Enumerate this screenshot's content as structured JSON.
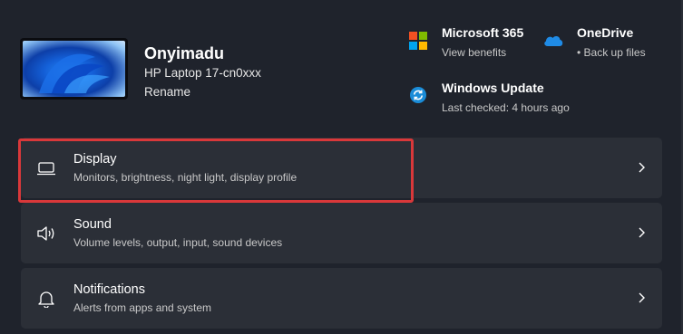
{
  "device": {
    "name": "Onyimadu",
    "model": "HP Laptop 17-cn0xxx",
    "rename_label": "Rename"
  },
  "tiles": {
    "microsoft365": {
      "title": "Microsoft 365",
      "subtitle": "View benefits"
    },
    "onedrive": {
      "title": "OneDrive",
      "subtitle": "• Back up files"
    },
    "windows_update": {
      "title": "Windows Update",
      "subtitle": "Last checked: 4 hours ago"
    }
  },
  "cards": [
    {
      "title": "Display",
      "subtitle": "Monitors, brightness, night light, display profile",
      "icon": "laptop-icon",
      "highlighted": true
    },
    {
      "title": "Sound",
      "subtitle": "Volume levels, output, input, sound devices",
      "icon": "speaker-icon"
    },
    {
      "title": "Notifications",
      "subtitle": "Alerts from apps and system",
      "icon": "bell-icon"
    }
  ],
  "colors": {
    "background": "#1f232c",
    "card": "#2b2f37",
    "highlight": "#d9383a",
    "ms_red": "#f25022",
    "ms_green": "#7fba00",
    "ms_blue": "#00a4ef",
    "ms_yellow": "#ffb900",
    "onedrive": "#1f8be6",
    "update": "#1a8cd8"
  }
}
